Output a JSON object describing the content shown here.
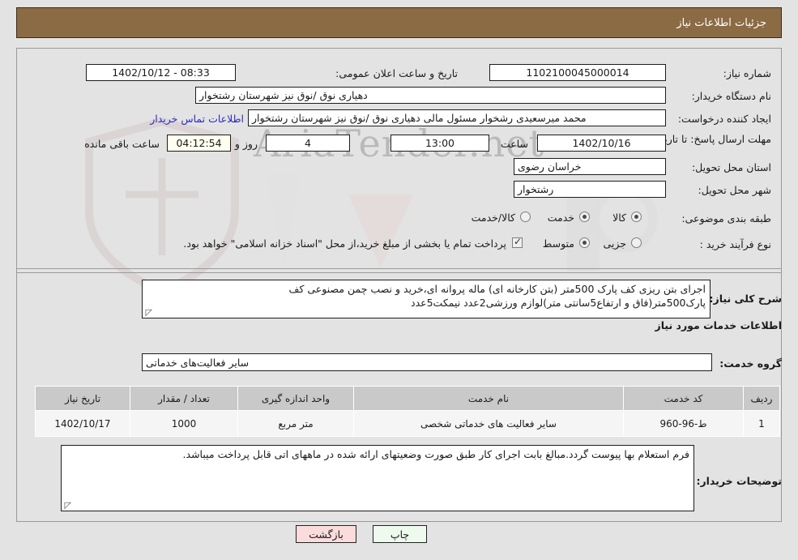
{
  "header": {
    "title": "جزئیات اطلاعات نیاز",
    "bar_color": "#8b6b43"
  },
  "watermark": {
    "text": "AriaTender.net"
  },
  "form": {
    "need_number_label": "شماره نیاز:",
    "need_number_value": "1102100045000014",
    "announce_label": "تاریخ و ساعت اعلان عمومی:",
    "announce_value": "08:33 - 1402/10/12",
    "buyer_org_label": "نام دستگاه خریدار:",
    "buyer_org_value": "دهیاری نوق /نوق نیز شهرستان رشتخوار",
    "requester_label": "ایجاد کننده درخواست:",
    "requester_value": "محمد میرسعیدی رشخوار مسئول مالی دهیاری نوق /نوق نیز شهرستان رشتخوار",
    "contact_link": "اطلاعات تماس خریدار",
    "deadline_label": "مهلت ارسال پاسخ: تا تاریخ:",
    "deadline_date": "1402/10/16",
    "hour_label": "ساعت",
    "hour_value": "13:00",
    "days_value": "4",
    "days_label": "روز و",
    "timer_value": "04:12:54",
    "remaining_label": "ساعت باقی مانده",
    "province_label": "استان محل تحویل:",
    "province_value": "خراسان رضوی",
    "city_label": "شهر محل تحویل:",
    "city_value": "رشتخوار",
    "category_label": "طبقه بندی موضوعی:",
    "category_options": [
      {
        "label": "کالا",
        "selected": false
      },
      {
        "label": "خدمت",
        "selected": true
      },
      {
        "label": "کالا/خدمت",
        "selected": false
      }
    ],
    "process_label": "نوع فرآیند خرید :",
    "process_options": [
      {
        "label": "جزیی",
        "selected": false
      },
      {
        "label": "متوسط",
        "selected": true
      }
    ],
    "treasury_checkbox_checked": true,
    "treasury_note": "پرداخت تمام یا بخشی از مبلغ خرید،از محل \"اسناد خزانه اسلامی\" خواهد بود."
  },
  "description": {
    "label": "شرح کلی نیاز:",
    "line1": "اجرای بتن ریزی کف پارک 500متر (بتن کارخانه ای) ماله پروانه ای،خرید و نصب چمن مصنوعی کف",
    "line2": "پارک500متر(فاق و ارتفاع5سانتی متر)لوازم ورزشی2عدد نیمکت5عدد"
  },
  "services": {
    "section_title": "اطلاعات خدمات مورد نیاز",
    "group_label": "گروه خدمت:",
    "group_value": "سایر فعالیت‌های خدماتی",
    "columns": [
      "ردیف",
      "کد خدمت",
      "نام خدمت",
      "واحد اندازه گیری",
      "تعداد / مقدار",
      "تاریخ نیاز"
    ],
    "rows": [
      {
        "index": "1",
        "code": "ط-96-960",
        "name": "سایر فعالیت های خدماتی شخصی",
        "unit": "متر مربع",
        "quantity": "1000",
        "date": "1402/10/17"
      }
    ]
  },
  "notes": {
    "label": "توضیحات خریدار:",
    "text": "فرم استعلام بها پیوست گردد.مبالغ بابت اجرای کار طبق صورت وضعیتهای ارائه شده  در ماههای اتی قابل پرداخت میباشد."
  },
  "footer": {
    "print_label": "چاپ",
    "back_label": "بازگشت"
  }
}
